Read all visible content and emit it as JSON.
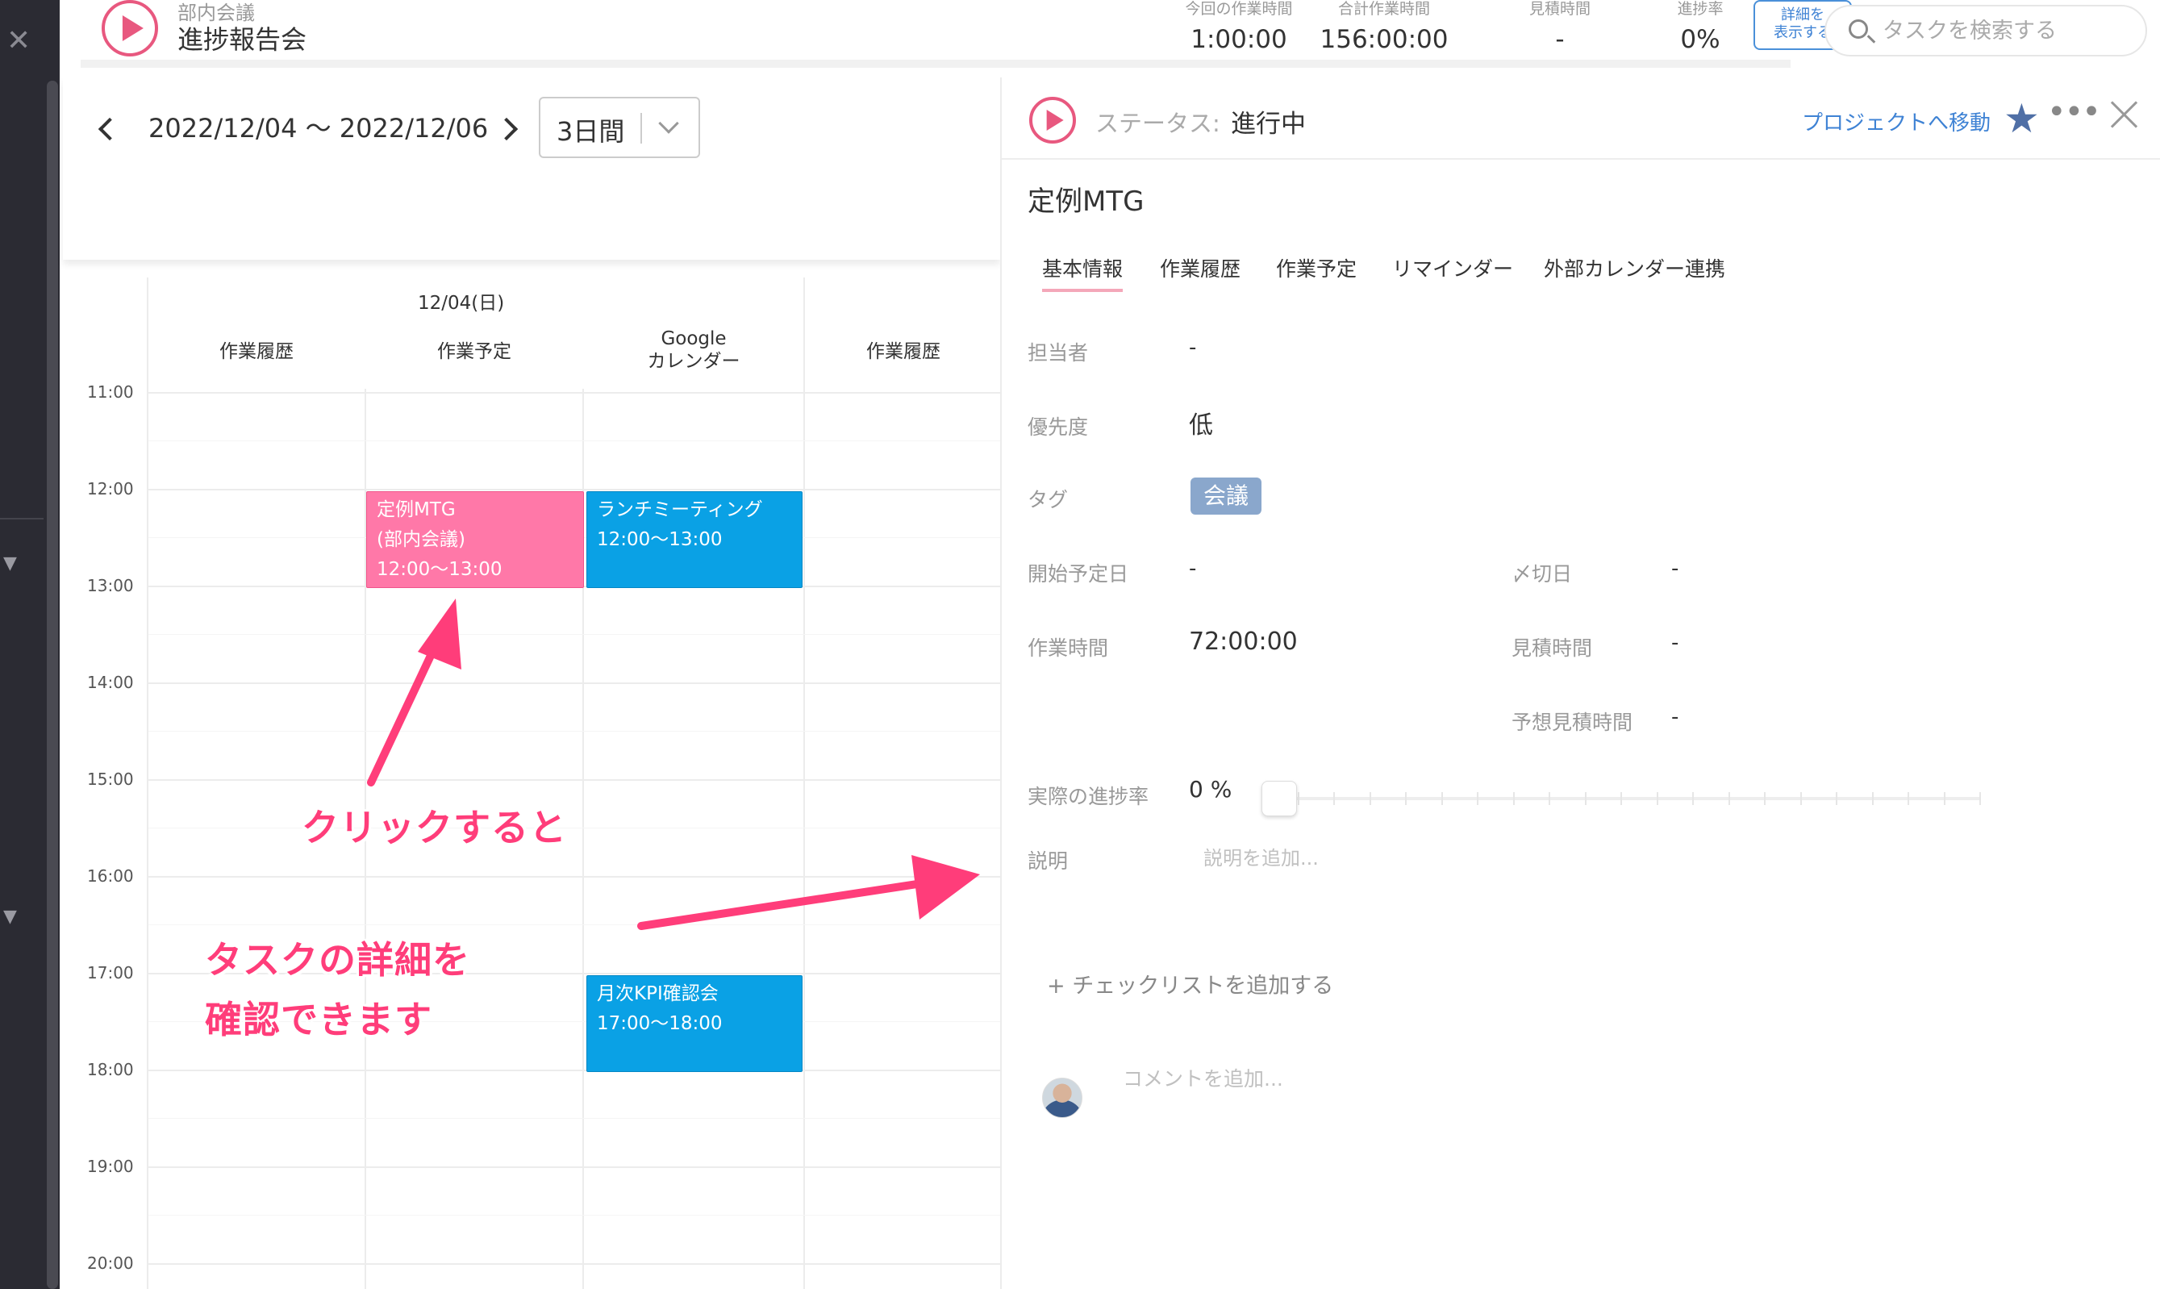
{
  "leftbar": {
    "close_icon": "close-icon",
    "collapse_icon_1": "triangle-down-icon",
    "collapse_icon_2": "triangle-down-icon"
  },
  "header": {
    "project": "部内会議",
    "title": "進捗報告会",
    "stats": [
      {
        "label": "今回の作業時間",
        "value": "1:00:00"
      },
      {
        "label": "合計作業時間",
        "value": "156:00:00"
      },
      {
        "label": "見積時間",
        "value": "-"
      },
      {
        "label": "進捗率",
        "value": "0%"
      }
    ],
    "detail_button_line1": "詳細を",
    "detail_button_line2": "表示する",
    "search_placeholder": "タスクを検索する"
  },
  "calendar": {
    "date_range": "2022/12/04 〜 2022/12/06",
    "period": "3日間",
    "day": "12/04(日)",
    "columns": [
      {
        "label": "作業履歴"
      },
      {
        "label": "作業予定"
      },
      {
        "label": "Google",
        "label2": "カレンダー"
      },
      {
        "label": "作業履歴"
      }
    ],
    "times": [
      "11:00",
      "12:00",
      "13:00",
      "14:00",
      "15:00",
      "16:00",
      "17:00",
      "18:00",
      "19:00",
      "20:00"
    ],
    "events": [
      {
        "line1": "定例MTG",
        "line2": "(部内会議)",
        "line3": "12:00〜13:00",
        "color": "#ff78a8"
      },
      {
        "line1": "ランチミーティング",
        "line2": "12:00〜13:00",
        "color": "#0aa1e5"
      },
      {
        "line1": "月次KPI確認会",
        "line2": "17:00〜18:00",
        "color": "#0aa1e5"
      }
    ]
  },
  "annotations": {
    "click": "クリックすると",
    "detail_line1": "タスクの詳細を",
    "detail_line2": "確認できます",
    "color": "#ff3d7a"
  },
  "panel": {
    "status_label": "ステータス:",
    "status_value": "進行中",
    "go_project": "プロジェクトへ移動",
    "task_title": "定例MTG",
    "tabs": [
      "基本情報",
      "作業履歴",
      "作業予定",
      "リマインダー",
      "外部カレンダー連携"
    ],
    "fields": {
      "assignee_label": "担当者",
      "assignee_value": "-",
      "priority_label": "優先度",
      "priority_value": "低",
      "tag_label": "タグ",
      "tag_value": "会議",
      "start_label": "開始予定日",
      "start_value": "-",
      "due_label": "〆切日",
      "due_value": "-",
      "work_label": "作業時間",
      "work_value": "72:00:00",
      "estimate_label": "見積時間",
      "estimate_value": "-",
      "forecast_label": "予想見積時間",
      "forecast_value": "-",
      "progress_label": "実際の進捗率",
      "progress_value": "0 %",
      "description_label": "説明",
      "description_placeholder": "説明を追加..."
    },
    "progress_fraction": 0,
    "add_checklist": "+ チェックリストを追加する",
    "comment_placeholder": "コメントを追加..."
  }
}
